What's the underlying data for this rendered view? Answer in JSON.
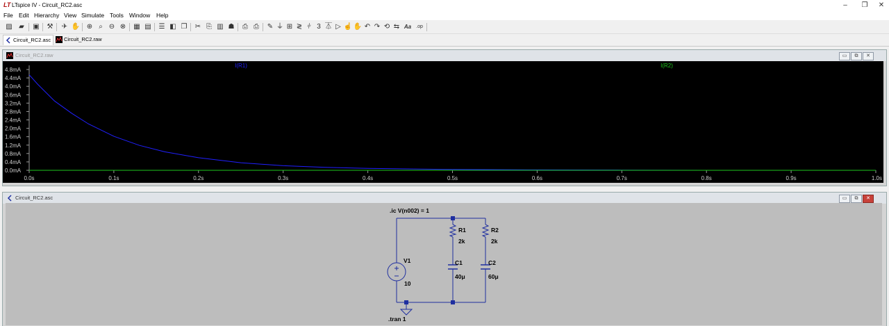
{
  "window": {
    "title": "LTspice IV - Circuit_RC2.asc",
    "app_icon": "LT",
    "controls": {
      "minimize": "–",
      "maximize": "❐",
      "close": "✕"
    }
  },
  "menu": [
    "File",
    "Edit",
    "Hierarchy",
    "View",
    "Simulate",
    "Tools",
    "Window",
    "Help"
  ],
  "toolbar": {
    "icons": [
      "new-schematic-icon",
      "open-icon",
      "save-icon",
      "control-panel-icon",
      "run-icon",
      "halt-icon",
      "zoom-in-icon",
      "pan-icon",
      "zoom-out-icon",
      "zoom-fit-icon",
      "autorange-icon",
      "grid-icon",
      "tile-horizontal-icon",
      "tile-vertical-icon",
      "cascade-icon",
      "cut-icon",
      "copy-icon",
      "paste-icon",
      "find-icon",
      "print-icon",
      "print-setup-icon",
      "wire-icon",
      "ground-icon",
      "label-net-icon",
      "resistor-icon",
      "capacitor-icon",
      "inductor-icon",
      "diode-icon",
      "component-icon",
      "move-icon",
      "drag-icon",
      "undo-icon",
      "redo-icon",
      "rotate-icon",
      "mirror-icon",
      "text-icon",
      "spice-directive-icon"
    ],
    "text_tool": "Aa",
    "op_tool": ".op"
  },
  "tabs": [
    {
      "label": "Circuit_RC2.asc",
      "active": true
    },
    {
      "label": "Circuit_RC2.raw",
      "active": false
    }
  ],
  "waveform_window": {
    "title": "Circuit_RC2.raw",
    "buttons": {
      "minimize": "▭",
      "restore": "⧉",
      "close": "✕"
    }
  },
  "schematic_window": {
    "title": "Circuit_RC2.asc",
    "buttons": {
      "minimize": "▭",
      "restore": "⧉",
      "close": "✕"
    }
  },
  "chart_data": {
    "type": "line",
    "background": "#000000",
    "grid": false,
    "x_ticks": [
      "0.0s",
      "0.1s",
      "0.2s",
      "0.3s",
      "0.4s",
      "0.5s",
      "0.6s",
      "0.7s",
      "0.8s",
      "0.9s",
      "1.0s"
    ],
    "y_ticks": [
      "4.8mA",
      "4.4mA",
      "4.0mA",
      "3.6mA",
      "3.2mA",
      "2.8mA",
      "2.4mA",
      "2.0mA",
      "1.6mA",
      "1.2mA",
      "0.8mA",
      "0.4mA",
      "0.0mA"
    ],
    "xlim": [
      0,
      1.0
    ],
    "ylim": [
      0,
      4.8
    ],
    "series": [
      {
        "name": "I(R1)",
        "color": "#2020ff",
        "x": [
          0,
          0.01,
          0.02,
          0.03,
          0.05,
          0.07,
          0.1,
          0.13,
          0.16,
          0.2,
          0.25,
          0.3,
          0.35,
          0.4,
          0.5,
          0.6,
          0.7,
          0.8,
          0.9,
          1.0
        ],
        "y": [
          4.55,
          4.1,
          3.7,
          3.3,
          2.72,
          2.21,
          1.62,
          1.19,
          0.88,
          0.6,
          0.36,
          0.22,
          0.14,
          0.09,
          0.04,
          0.02,
          0.01,
          0.0,
          0.0,
          0.0
        ]
      },
      {
        "name": "I(R2)",
        "color": "#1ec81e",
        "x": [
          0,
          1.0
        ],
        "y": [
          0,
          0
        ]
      }
    ]
  },
  "schematic": {
    "directives": {
      "ic": ".ic V(n002) = 1",
      "tran": ".tran 1"
    },
    "components": [
      {
        "ref": "V1",
        "value": "10"
      },
      {
        "ref": "R1",
        "value": "2k"
      },
      {
        "ref": "R2",
        "value": "2k"
      },
      {
        "ref": "C1",
        "value": "40μ"
      },
      {
        "ref": "C2",
        "value": "60μ"
      }
    ],
    "wire_color": "#1f2fa0"
  }
}
